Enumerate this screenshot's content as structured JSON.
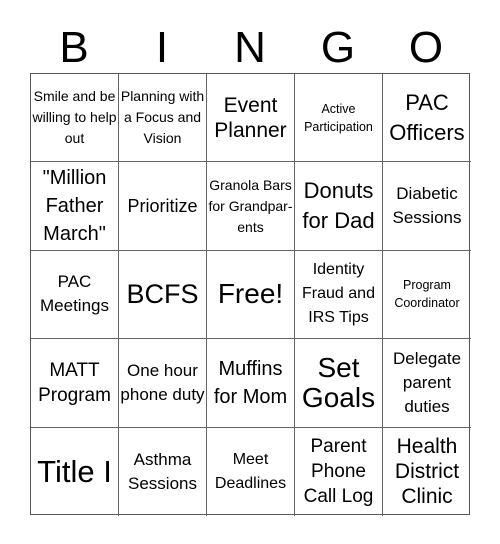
{
  "header": {
    "letters": [
      "B",
      "I",
      "N",
      "G",
      "O"
    ]
  },
  "cells": [
    "Smile and be willing to help out",
    "Planning with a Focus and Vision",
    "Event Planner",
    "Active Participation",
    "PAC Officers",
    "\"Million Father March\"",
    "Prioritize",
    "Granola Bars for Grandpar-ents",
    "Donuts for Dad",
    "Diabetic Sessions",
    "PAC Meetings",
    "BCFS",
    "Free!",
    "Identity Fraud and IRS Tips",
    "Program Coordinator",
    "MATT Program",
    "One hour phone duty",
    "Muffins for Mom",
    "Set Goals",
    "Delegate parent duties",
    "Title I",
    "Asthma Sessions",
    "Meet Deadlines",
    "Parent Phone Call Log",
    "Health District Clinic"
  ]
}
